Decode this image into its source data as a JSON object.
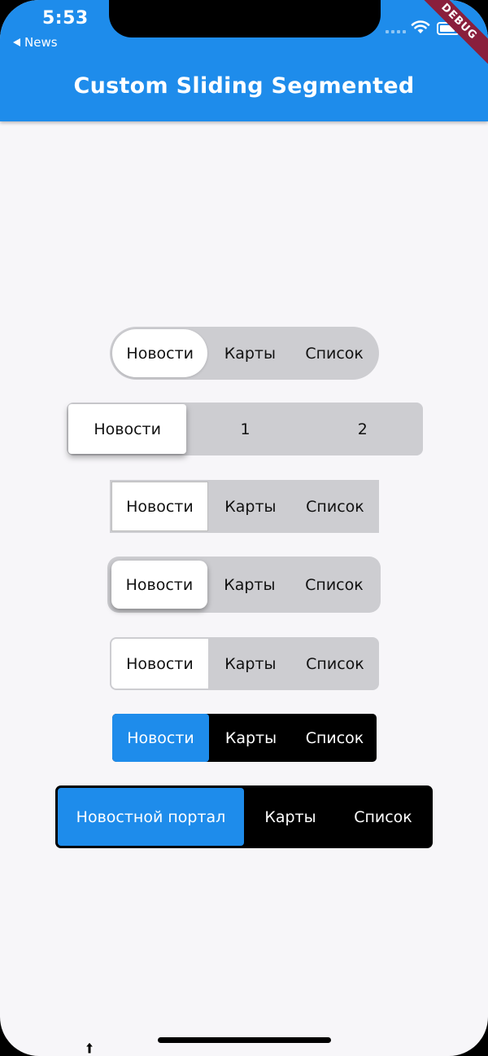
{
  "status_bar": {
    "time": "5:53",
    "back_label": "News",
    "debug_label": "DEBUG"
  },
  "app_bar": {
    "title": "Custom Sliding Segmented",
    "color": "#1e8ceb"
  },
  "controls": [
    {
      "items": [
        "Новости",
        "Карты",
        "Список"
      ],
      "selected": 0,
      "style": "pill"
    },
    {
      "items": [
        "Новости",
        "1",
        "2"
      ],
      "selected": 0,
      "style": "rounded-shadow"
    },
    {
      "items": [
        "Новости",
        "Карты",
        "Список"
      ],
      "selected": 0,
      "style": "square"
    },
    {
      "items": [
        "Новости",
        "Карты",
        "Список"
      ],
      "selected": 0,
      "style": "rounded-thumb-shadow"
    },
    {
      "items": [
        "Новости",
        "Карты",
        "Список"
      ],
      "selected": 0,
      "style": "rounded"
    },
    {
      "items": [
        "Новости",
        "Карты",
        "Список"
      ],
      "selected": 0,
      "style": "dark-blue"
    },
    {
      "items": [
        "Новостной портал",
        "Карты",
        "Список"
      ],
      "selected": 0,
      "style": "dark-blue-large"
    }
  ],
  "colors": {
    "background": "#f7f6f9",
    "segment_track": "#cdcdd1",
    "accent": "#1e8ceb",
    "dark_track": "#000000"
  }
}
